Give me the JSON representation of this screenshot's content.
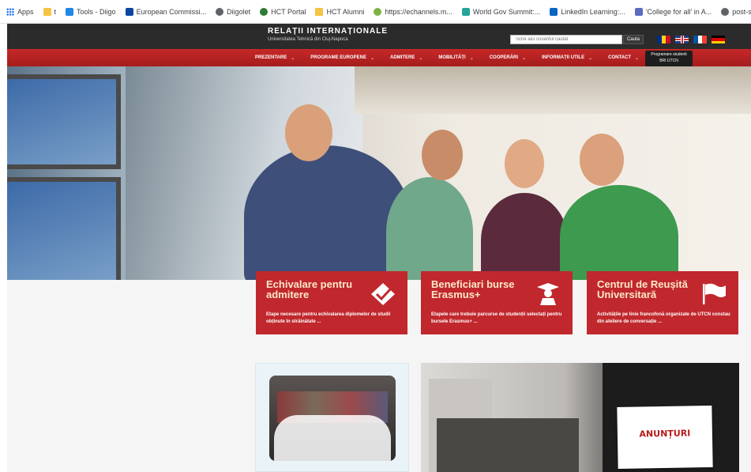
{
  "bookmarks": [
    {
      "label": "Apps",
      "icon": "apps-grid-icon"
    },
    {
      "label": "t",
      "icon": "folder-icon"
    },
    {
      "label": "Tools - Diigo",
      "icon": "diigo-icon"
    },
    {
      "label": "European Commissi...",
      "icon": "eu-flag-icon"
    },
    {
      "label": "Diigolet",
      "icon": "globe-icon"
    },
    {
      "label": "HCT Portal",
      "icon": "hct-icon"
    },
    {
      "label": "HCT Alumni",
      "icon": "folder-icon"
    },
    {
      "label": "https://echannels.m...",
      "icon": "echannels-icon"
    },
    {
      "label": "World Gov Summit:...",
      "icon": "wgs-icon"
    },
    {
      "label": "LinkedIn Learning:...",
      "icon": "linkedin-icon"
    },
    {
      "label": "'College for all' in A...",
      "icon": "article-icon"
    },
    {
      "label": "post-secondary-bro...",
      "icon": "globe-icon"
    }
  ],
  "header": {
    "title": "RELAȚII INTERNAȚIONALE",
    "subtitle": "Universitatea Tehnică din Cluj-Napoca",
    "search_placeholder": "Scrie aici cuvantul cautat",
    "search_button": "Cauta",
    "languages": [
      "Română",
      "English",
      "Français",
      "Deutsch"
    ]
  },
  "nav": {
    "items": [
      "PREZENTARE",
      "PROGRAME EUROPENE",
      "ADMITERE",
      "MOBILITĂȚI",
      "COOPERĂRI",
      "INFORMAȚII UTILE",
      "CONTACT"
    ],
    "program_button_line1": "Programare studenti",
    "program_button_line2": "BRI UTCN"
  },
  "cards": [
    {
      "title": "Echivalare pentru admitere",
      "desc": "Etape necesare pentru echivalarea diplomelor de studii obținute în străinătate ...",
      "icon": "checkmark-badge-icon"
    },
    {
      "title": "Beneficiari burse Erasmus+",
      "desc": "Etapele care trebuie parcurse de studenții selectați pentru bursele Erasmus+ ...",
      "icon": "graduate-icon"
    },
    {
      "title": "Centrul de Reușită Universitară",
      "desc": "Activitățile pe linie francofonă organizate de UTCN constau din ateliere de conversație ...",
      "icon": "flag-icon"
    }
  ],
  "anunturi": {
    "sign_text": "ANUNȚURI"
  },
  "colors": {
    "accent_red": "#c0282d",
    "header_dark": "#2b2b2b",
    "card_title": "#fde8c8"
  }
}
